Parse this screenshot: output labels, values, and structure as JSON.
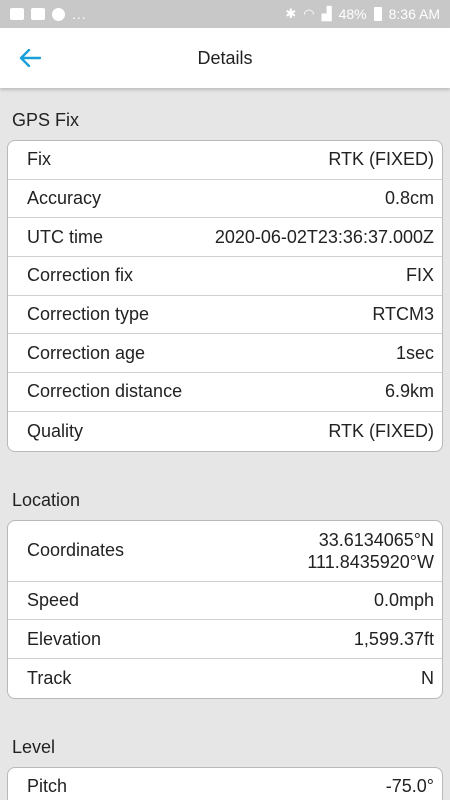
{
  "statusbar": {
    "more": "...",
    "battery": "48%",
    "time": "8:36 AM"
  },
  "header": {
    "title": "Details",
    "accent": "#1aa0d8"
  },
  "sections": {
    "gps": {
      "title": "GPS Fix",
      "rows": [
        {
          "label": "Fix",
          "value": "RTK (FIXED)"
        },
        {
          "label": "Accuracy",
          "value": "0.8cm"
        },
        {
          "label": "UTC time",
          "value": "2020-06-02T23:36:37.000Z"
        },
        {
          "label": "Correction fix",
          "value": "FIX"
        },
        {
          "label": "Correction type",
          "value": "RTCM3"
        },
        {
          "label": "Correction age",
          "value": "1sec"
        },
        {
          "label": "Correction distance",
          "value": "6.9km"
        },
        {
          "label": "Quality",
          "value": "RTK (FIXED)"
        }
      ]
    },
    "location": {
      "title": "Location",
      "coordinates": {
        "label": "Coordinates",
        "lat": "33.6134065°N",
        "lon": "111.8435920°W"
      },
      "rows": [
        {
          "label": "Speed",
          "value": "0.0mph"
        },
        {
          "label": "Elevation",
          "value": "1,599.37ft"
        },
        {
          "label": "Track",
          "value": "N"
        }
      ]
    },
    "level": {
      "title": "Level",
      "rows": [
        {
          "label": "Pitch",
          "value": "-75.0°"
        }
      ]
    }
  }
}
